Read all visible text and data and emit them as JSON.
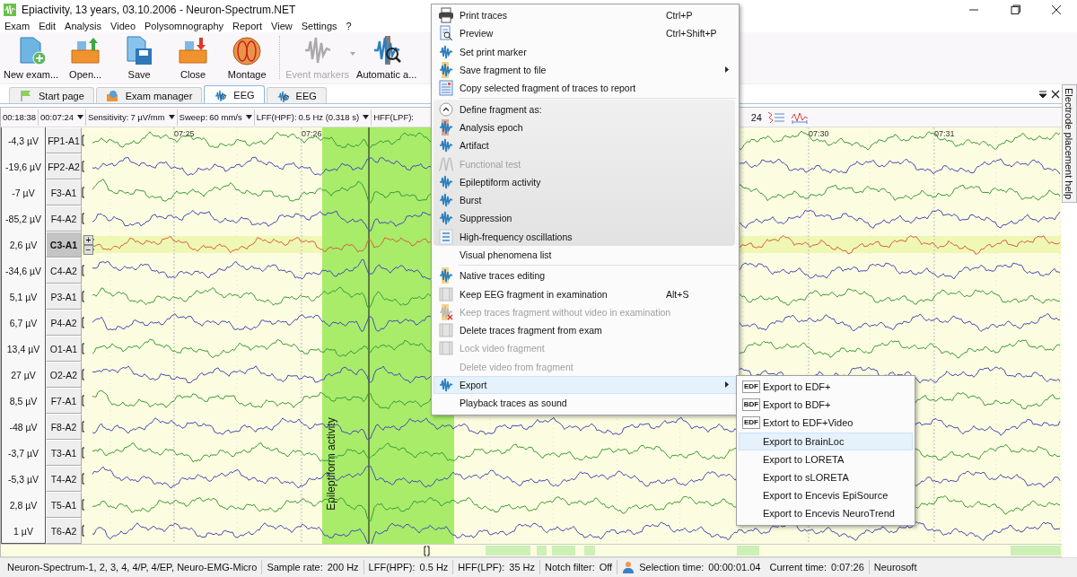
{
  "window": {
    "title": "Epiactivity, 13 years, 03.10.2006 - Neuron-Spectrum.NET"
  },
  "menu_bar": [
    "Exam",
    "Edit",
    "Analysis",
    "Video",
    "Polysomnography",
    "Report",
    "View",
    "Settings",
    "?"
  ],
  "toolbar": [
    {
      "label": "New exam...",
      "disabled": false,
      "dropdown": false
    },
    {
      "label": "Open...",
      "disabled": false,
      "dropdown": false
    },
    {
      "label": "Save",
      "disabled": false,
      "dropdown": false
    },
    {
      "label": "Close",
      "disabled": false,
      "dropdown": false
    },
    {
      "label": "Montage",
      "disabled": false,
      "dropdown": false
    },
    {
      "label": "Event markers",
      "disabled": true,
      "dropdown": true
    },
    {
      "label": "Automatic a...",
      "disabled": false,
      "dropdown": false
    }
  ],
  "tabs": [
    {
      "label": "Start page",
      "selected": false
    },
    {
      "label": "Exam manager",
      "selected": false
    },
    {
      "label": "EEG",
      "selected": true
    },
    {
      "label": "EEG",
      "selected": false
    }
  ],
  "eeg_toolbar": {
    "start_time": "00:18:38",
    "current_time": "00:07:24",
    "sensitivity_label": "Sensitivity:",
    "sensitivity": "7 µV/mm",
    "sweep_label": "Sweep:",
    "sweep": "60 mm/s",
    "lff_label": "LFF(HPF):",
    "lff": "0.5 Hz (0.318 s)",
    "hff_label": "HFF(LPF):",
    "tail": "24"
  },
  "time_marks": [
    "07:25",
    "07:26",
    "07:30",
    "07:31"
  ],
  "channels": [
    {
      "value": "-4,3 µV",
      "label": "FP1-A1",
      "selected": false,
      "color": "#3c9a3c"
    },
    {
      "value": "-19,6 µV",
      "label": "FP2-A2",
      "selected": false,
      "color": "#4a4ab8"
    },
    {
      "value": "-7 µV",
      "label": "F3-A1",
      "selected": false,
      "color": "#3c9a3c"
    },
    {
      "value": "-85,2 µV",
      "label": "F4-A2",
      "selected": false,
      "color": "#4a4ab8"
    },
    {
      "value": "2,6 µV",
      "label": "C3-A1",
      "selected": true,
      "color": "#d8603c"
    },
    {
      "value": "-34,6 µV",
      "label": "C4-A2",
      "selected": false,
      "color": "#4a4ab8"
    },
    {
      "value": "5,1 µV",
      "label": "P3-A1",
      "selected": false,
      "color": "#3c9a3c"
    },
    {
      "value": "6,7 µV",
      "label": "P4-A2",
      "selected": false,
      "color": "#4a4ab8"
    },
    {
      "value": "13,4 µV",
      "label": "O1-A1",
      "selected": false,
      "color": "#3c9a3c"
    },
    {
      "value": "27 µV",
      "label": "O2-A2",
      "selected": false,
      "color": "#4a4ab8"
    },
    {
      "value": "8,5 µV",
      "label": "F7-A1",
      "selected": false,
      "color": "#3c9a3c"
    },
    {
      "value": "-48 µV",
      "label": "F8-A2",
      "selected": false,
      "color": "#4a4ab8"
    },
    {
      "value": "-3,7 µV",
      "label": "T3-A1",
      "selected": false,
      "color": "#3c9a3c"
    },
    {
      "value": "-5,3 µV",
      "label": "T4-A2",
      "selected": false,
      "color": "#4a4ab8"
    },
    {
      "value": "2,8 µV",
      "label": "T5-A1",
      "selected": false,
      "color": "#3c9a3c"
    },
    {
      "value": "1 µV",
      "label": "T6-A2",
      "selected": false,
      "color": "#4a4ab8"
    }
  ],
  "scale_buttons": [
    "+",
    "−"
  ],
  "fragment": {
    "label": "Epileptiform activity"
  },
  "side_panel": {
    "title": "Electrode placement help"
  },
  "status_bar": {
    "devices": "Neuron-Spectrum-1, 2, 3, 4, 4/P, 4/EP, Neuro-EMG-Micro",
    "sample_rate_label": "Sample rate:",
    "sample_rate": "200 Hz",
    "lff_label": "LFF(HPF):",
    "lff": "0.5 Hz",
    "hff_label": "HFF(LPF):",
    "hff": "35 Hz",
    "notch_label": "Notch filter:",
    "notch": "Off",
    "selection_label": "Selection time:",
    "selection": "00:00:01.04",
    "current_label": "Current time:",
    "current": "0:07:26",
    "vendor": "Neurosoft"
  },
  "context_menu": {
    "items": [
      {
        "kind": "item",
        "label": "Print traces",
        "shortcut": "Ctrl+P",
        "disabled": false,
        "submenu": false,
        "selected": false
      },
      {
        "kind": "item",
        "label": "Preview",
        "shortcut": "Ctrl+Shift+P",
        "disabled": false,
        "submenu": false,
        "selected": false
      },
      {
        "kind": "item",
        "label": "Set print marker",
        "disabled": false,
        "submenu": false,
        "selected": false
      },
      {
        "kind": "item",
        "label": "Save fragment to file",
        "disabled": false,
        "submenu": true,
        "selected": false
      },
      {
        "kind": "item",
        "label": "Copy selected fragment of traces to report",
        "disabled": false,
        "submenu": false,
        "selected": false
      },
      {
        "kind": "separator"
      },
      {
        "kind": "group",
        "title": "Define fragment as:",
        "expanded": true,
        "items": [
          {
            "label": "Analysis epoch",
            "disabled": false,
            "selected": false
          },
          {
            "label": "Artifact",
            "disabled": false,
            "selected": false
          },
          {
            "label": "Functional test",
            "disabled": true,
            "selected": false
          },
          {
            "label": "Epileptiform activity",
            "disabled": false,
            "selected": false
          },
          {
            "label": "Burst",
            "disabled": false,
            "selected": false
          },
          {
            "label": "Suppression",
            "disabled": false,
            "selected": false
          },
          {
            "label": "High-frequency oscillations",
            "disabled": false,
            "selected": false
          }
        ]
      },
      {
        "kind": "item",
        "label": "Visual phenomena list",
        "disabled": false,
        "submenu": false,
        "selected": false
      },
      {
        "kind": "separator"
      },
      {
        "kind": "item",
        "label": "Native traces editing",
        "disabled": false,
        "submenu": false,
        "selected": false
      },
      {
        "kind": "item",
        "label": "Keep EEG fragment in examination",
        "shortcut": "Alt+S",
        "disabled": false,
        "submenu": false,
        "selected": false
      },
      {
        "kind": "item",
        "label": "Keep traces fragment without video in examination",
        "disabled": true,
        "submenu": false,
        "selected": false
      },
      {
        "kind": "item",
        "label": "Delete traces fragment from exam",
        "disabled": false,
        "submenu": false,
        "selected": false
      },
      {
        "kind": "item",
        "label": "Lock video fragment",
        "disabled": true,
        "submenu": false,
        "selected": false
      },
      {
        "kind": "item",
        "label": "Delete video from fragment",
        "disabled": true,
        "submenu": false,
        "selected": false
      },
      {
        "kind": "item",
        "label": "Export",
        "disabled": false,
        "submenu": true,
        "selected": true
      },
      {
        "kind": "item",
        "label": "Playback traces as sound",
        "disabled": false,
        "submenu": false,
        "selected": false
      }
    ]
  },
  "export_menu": {
    "items": [
      {
        "label": "Export to EDF+",
        "badge": "EDF",
        "selected": false
      },
      {
        "label": "Export to BDF+",
        "badge": "BDF",
        "selected": false
      },
      {
        "label": "Extort to EDF+Video",
        "badge": "EDF",
        "selected": false
      },
      {
        "label": "Export to BrainLoc",
        "selected": true
      },
      {
        "label": "Export to LORETA",
        "selected": false
      },
      {
        "label": "Export to sLORETA",
        "selected": false
      },
      {
        "label": "Export to Encevis EpiSource",
        "selected": false
      },
      {
        "label": "Export to Encevis NeuroTrend",
        "selected": false
      }
    ]
  }
}
